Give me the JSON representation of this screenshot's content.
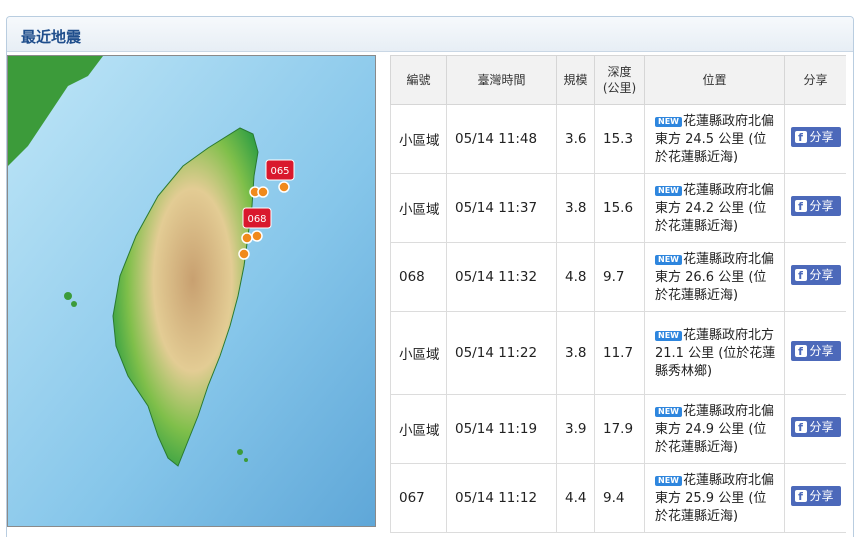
{
  "panel": {
    "title": "最近地震"
  },
  "table": {
    "headers": [
      "編號",
      "臺灣時間",
      "規模",
      "深度\n(公里)",
      "位置",
      "分享"
    ],
    "rows": [
      {
        "id": "小區域",
        "time": "05/14 11:48",
        "mag": "3.6",
        "depth": "15.3",
        "badge": "NEW",
        "location": "花蓮縣政府北偏東方 24.5 公里 (位於花蓮縣近海)",
        "share": "分享"
      },
      {
        "id": "小區域",
        "time": "05/14 11:37",
        "mag": "3.8",
        "depth": "15.6",
        "badge": "NEW",
        "location": "花蓮縣政府北偏東方 24.2 公里 (位於花蓮縣近海)",
        "share": "分享"
      },
      {
        "id": "068",
        "time": "05/14 11:32",
        "mag": "4.8",
        "depth": "9.7",
        "badge": "NEW",
        "location": "花蓮縣政府北偏東方 26.6 公里 (位於花蓮縣近海)",
        "share": "分享"
      },
      {
        "id": "小區域",
        "time": "05/14 11:22",
        "mag": "3.8",
        "depth": "11.7",
        "badge": "NEW",
        "location": "花蓮縣政府北方 21.1 公里 (位於花蓮縣秀林鄉)",
        "share": "分享"
      },
      {
        "id": "小區域",
        "time": "05/14 11:19",
        "mag": "3.9",
        "depth": "17.9",
        "badge": "NEW",
        "location": "花蓮縣政府北偏東方 24.9 公里 (位於花蓮縣近海)",
        "share": "分享"
      },
      {
        "id": "067",
        "time": "05/14 11:12",
        "mag": "4.4",
        "depth": "9.4",
        "badge": "NEW",
        "location": "花蓮縣政府北偏東方 25.9 公里 (位於花蓮縣近海)",
        "share": "分享"
      }
    ]
  },
  "map": {
    "markers": [
      "065",
      "068"
    ],
    "colors": {
      "sea": "#9fd0ec",
      "lowland": "#2f9e44",
      "highland": "#d9b98a",
      "marker": "#d9182d",
      "quake_dot": "#f08a1c"
    }
  }
}
